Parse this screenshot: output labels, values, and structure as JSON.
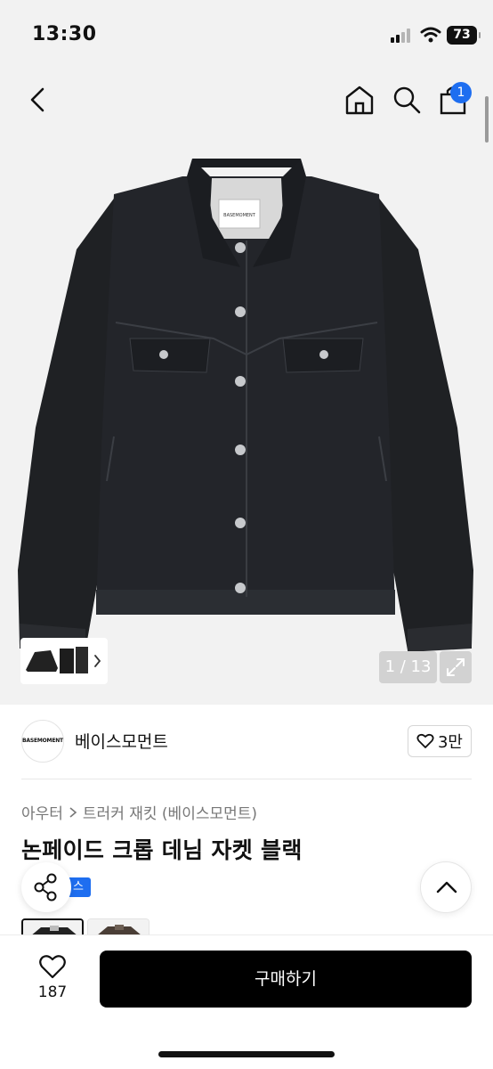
{
  "status_bar": {
    "time": "13:30",
    "battery": "73"
  },
  "nav": {
    "cart_badge": "1"
  },
  "gallery": {
    "counter": "1 / 13"
  },
  "brand": {
    "logo_text": "BASEMOMENT",
    "name": "베이스모먼트",
    "like_count": "3만"
  },
  "breadcrumb": {
    "category": "아우터",
    "subcategory": "트러커 재킷 (베이스모먼트)"
  },
  "product": {
    "title": "논페이드 크롭 데님 자켓 블랙",
    "tag": "스타"
  },
  "bottom_bar": {
    "wish_count": "187",
    "buy_label": "구매하기"
  },
  "icons": {
    "back": "chevron-left-icon",
    "home": "home-icon",
    "search": "search-icon",
    "cart": "shopping-bag-icon",
    "expand": "expand-icon",
    "like": "heart-icon",
    "share": "share-icon",
    "top": "chevron-up-icon"
  },
  "colors": {
    "accent": "#1e6ef0",
    "buy_button": "#000000",
    "background_gray": "#f2f2f2"
  }
}
